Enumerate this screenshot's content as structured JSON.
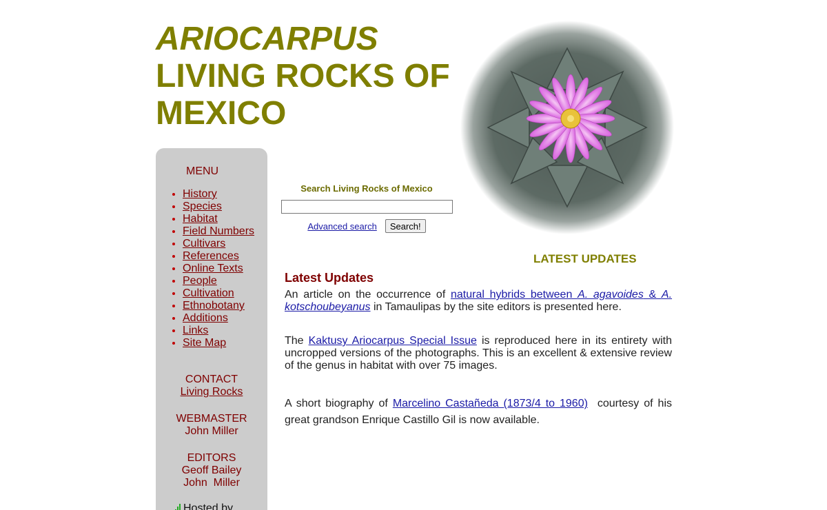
{
  "header": {
    "title_line1": "ARIOCARPUS",
    "title_line2": "LIVING ROCKS OF",
    "title_line3": "MEXICO"
  },
  "sidebar": {
    "menu_title": "MENU",
    "items": [
      {
        "label": "History"
      },
      {
        "label": "Species"
      },
      {
        "label": "Habitat"
      },
      {
        "label": "Field Numbers"
      },
      {
        "label": "Cultivars"
      },
      {
        "label": "References"
      },
      {
        "label": "Online Texts"
      },
      {
        "label": "People"
      },
      {
        "label": "Cultivation"
      },
      {
        "label": "Ethnobotany"
      },
      {
        "label": "Additions"
      },
      {
        "label": "Links"
      },
      {
        "label": "Site Map"
      }
    ],
    "contact": {
      "heading": "CONTACT",
      "link": "Living Rocks"
    },
    "webmaster": {
      "heading": "WEBMASTER",
      "name": "John Miller"
    },
    "editors": {
      "heading": "EDITORS",
      "names": [
        "Geoff Bailey",
        "John  Miller"
      ]
    },
    "hosted": "Hosted by"
  },
  "search": {
    "label": "Search Living Rocks of Mexico",
    "value": "",
    "advanced_link": "Advanced search",
    "button": "Search!"
  },
  "updates": {
    "section_heading": "LATEST UPDATES",
    "title": "Latest Updates",
    "p1": {
      "before": "An article on the occurrence of ",
      "link_a": "natural hybrids between ",
      "link_b": "A. agavoides",
      "link_c": " & ",
      "link_d": "A. kotschoubeyanus",
      "after": " in Tamaulipas by the site editors is presented here."
    },
    "p2": {
      "before": "The ",
      "link": "Kaktusy Ariocarpus Special Issue",
      "after": " is reproduced here in its entirety with uncropped versions of the photographs. This is an excellent & extensive review of the genus in habitat  with over 75 images."
    },
    "p3": {
      "before": "A short biography of ",
      "link": "Marcelino Castañeda (1873/4 to 1960)",
      "after": "  courtesy of his great grandson Enrique Castillo Gil is now available."
    }
  },
  "colors": {
    "title_olive": "#7f7f00",
    "menu_maroon": "#7f0000",
    "sidebar_gray": "#cccccc",
    "link_blue": "#1a1aa6",
    "flower_pink": "#e07ae8"
  }
}
